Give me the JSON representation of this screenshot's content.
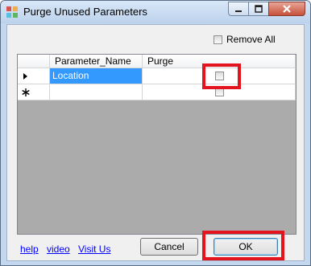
{
  "window": {
    "title": "Purge Unused Parameters"
  },
  "title_controls": {
    "minimize_icon": "minimize-icon",
    "maximize_icon": "maximize-icon",
    "close_icon": "close-icon"
  },
  "remove_all": {
    "label": "Remove All",
    "checked": false
  },
  "grid": {
    "columns": [
      "Parameter_Name",
      "Purge"
    ],
    "rows": [
      {
        "indicator": "current-row-arrow",
        "parameter_name": "Location",
        "purge": false,
        "selected": true
      },
      {
        "indicator": "new-row-asterisk",
        "parameter_name": "",
        "purge": false,
        "selected": false
      }
    ]
  },
  "footer": {
    "links": {
      "help": "help",
      "video": "video",
      "visit_us": "Visit Us"
    },
    "cancel_label": "Cancel",
    "ok_label": "OK"
  },
  "colors": {
    "highlight": "#e4141e",
    "selection": "#3399ff",
    "grid_background": "#ababab",
    "link": "#0000ff"
  }
}
